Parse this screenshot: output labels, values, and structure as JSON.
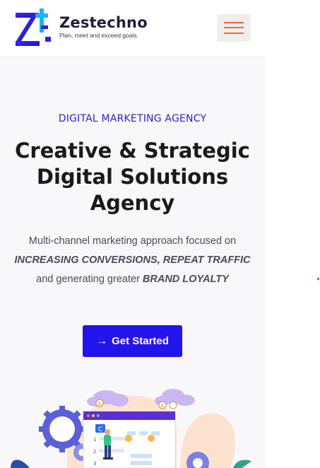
{
  "brand": {
    "name": "Zestechno",
    "tagline": "Plan, meet and exceed goals."
  },
  "header": {
    "menu_icon": "hamburger-icon"
  },
  "hero": {
    "eyebrow": "DIGITAL MARKETING AGENCY",
    "headline_line1": "Creative & Strategic",
    "headline_line2": "Digital Solutions",
    "headline_line3": "Agency",
    "desc_part1": "Multi-channel marketing approach focused on",
    "desc_bold1": "INCREASING CONVERSIONS, REPEAT TRAFFIC",
    "desc_part2": "and generating greater",
    "desc_bold2": "BRAND LOYALTY",
    "cta_label": "Get Started",
    "cta_icon": "arrow-right-icon"
  },
  "illustration": {
    "bubble_a": "$",
    "bubble_b": "$",
    "tab_label": "C",
    "row_1": "1",
    "row_2": "2",
    "row_3": "3"
  },
  "colors": {
    "accent": "#2414ec",
    "eyebrow": "#2a1ee0",
    "menu_lines": "#f06a3a",
    "logo_blue": "#2a22e6",
    "logo_cyan": "#18b6f0"
  }
}
